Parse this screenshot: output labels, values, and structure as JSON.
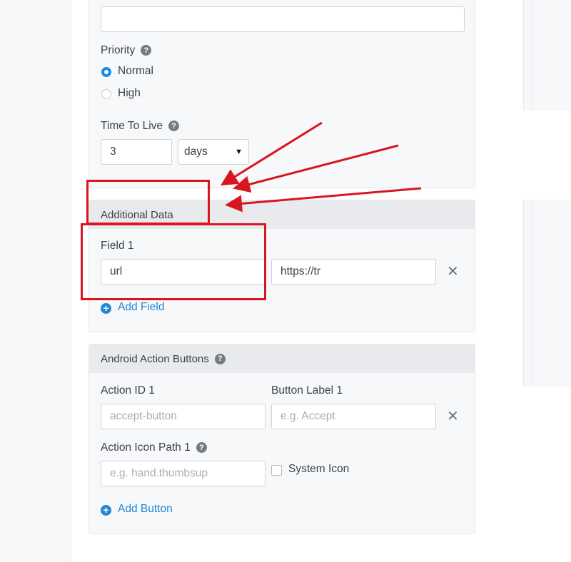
{
  "colors": {
    "accent": "#1e88e5",
    "link": "#2087d6",
    "annotation": "#d9161f"
  },
  "top_input": {
    "value": "",
    "placeholder": ""
  },
  "priority": {
    "label": "Priority",
    "help_icon": "question-circle-icon",
    "options": [
      {
        "label": "Normal",
        "selected": true
      },
      {
        "label": "High",
        "selected": false
      }
    ]
  },
  "ttl": {
    "label": "Time To Live",
    "help_icon": "question-circle-icon",
    "value": "3",
    "unit": "days",
    "unit_icon": "caret-down-icon"
  },
  "additional_data": {
    "header": "Additional Data",
    "field_label": "Field 1",
    "key_value": "url",
    "value_value": "https://tr",
    "remove_icon": "close-icon",
    "add_label": "Add Field",
    "add_icon": "plus-circle-icon"
  },
  "android_buttons": {
    "header": "Android Action Buttons",
    "help_icon": "question-circle-icon",
    "action_id_label": "Action ID 1",
    "action_id_placeholder": "accept-button",
    "button_label_label": "Button Label 1",
    "button_label_placeholder": "e.g. Accept",
    "remove_icon": "close-icon",
    "icon_path_label": "Action Icon Path 1",
    "icon_path_placeholder": "e.g. hand.thumbsup",
    "system_icon_label": "System Icon",
    "system_icon_checked": false,
    "add_label": "Add Button",
    "add_icon": "plus-circle-icon"
  }
}
